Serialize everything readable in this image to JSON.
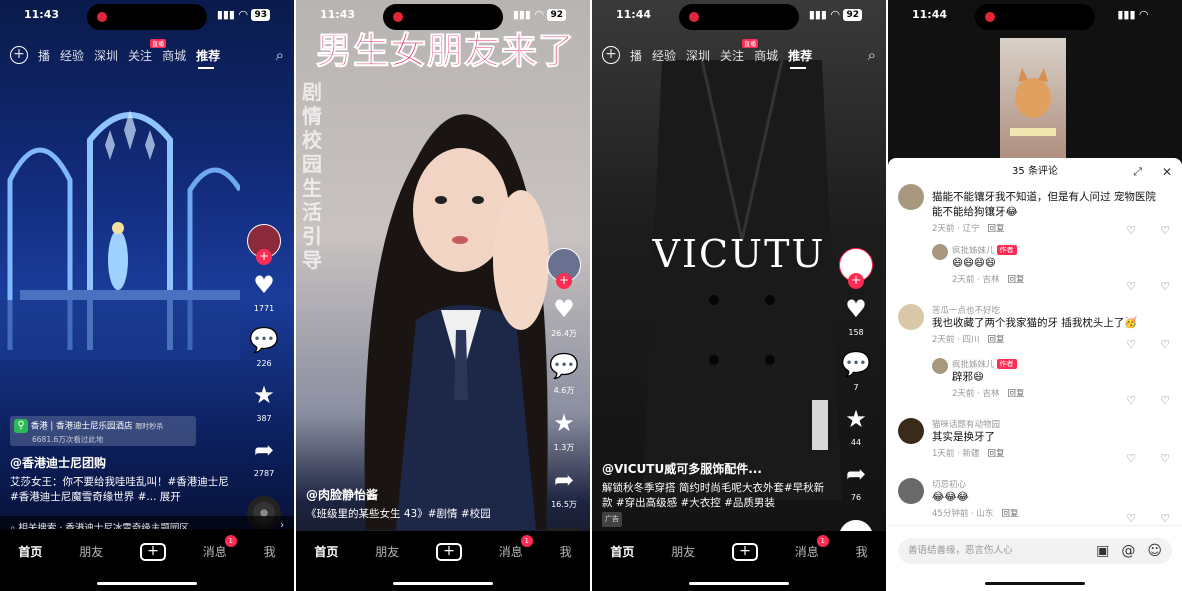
{
  "phones": [
    {
      "time": "11:43",
      "battery": "93",
      "nav": {
        "plus": "+",
        "tabs": [
          "播",
          "经验",
          "深圳",
          "关注",
          "商城",
          "推荐"
        ],
        "live_badge": "直播",
        "active": "推荐"
      },
      "rail": {
        "likes": "1771",
        "comments": "226",
        "favorites": "387",
        "shares": "2787"
      },
      "location": {
        "city": "香港",
        "place": "香港迪士尼乐园酒店",
        "promo": "限时秒杀",
        "views": "6681.6万次看过此地"
      },
      "author": "@香港迪士尼团购",
      "caption": "艾莎女王：你不要给我哇哇乱叫！#香港迪士尼 #香港迪士尼魔雪奇缘世界 #... 展开",
      "related": "相关搜索 · 香港迪士尼冰雪奇缘主题园区",
      "bottom": [
        "首页",
        "朋友",
        "+",
        "消息",
        "我"
      ],
      "msg_badge": "1"
    },
    {
      "time": "11:43",
      "battery": "92",
      "title_overlay": "男生女朋友来了",
      "vertical_text": "剧情校园生活引导",
      "rail": {
        "likes": "26.4万",
        "comments": "4.6万",
        "favorites": "1.3万",
        "shares": "16.5万"
      },
      "author": "@肉脸静怡酱",
      "caption": "《班级里的某些女生 43》#剧情 #校园",
      "bottom": [
        "首页",
        "朋友",
        "+",
        "消息",
        "我"
      ],
      "msg_badge": "1"
    },
    {
      "time": "11:44",
      "battery": "92",
      "nav": {
        "plus": "+",
        "tabs": [
          "播",
          "经验",
          "深圳",
          "关注",
          "商城",
          "推荐"
        ],
        "live_badge": "直播",
        "active": "推荐"
      },
      "brand": "VICUTU",
      "rail": {
        "likes": "158",
        "comments": "7",
        "favorites": "44",
        "shares": "76"
      },
      "author": "@VICUTU威可多服饰配件...",
      "caption": "解锁秋冬季穿搭 简约时尚毛呢大衣外套#早秋新款 #穿出高级感 #大衣控 #品质男装",
      "ad": "广告",
      "bottom": [
        "首页",
        "朋友",
        "+",
        "消息",
        "我"
      ],
      "msg_badge": "1"
    },
    {
      "time": "11:44",
      "header": "35 条评论",
      "comments": [
        {
          "name": "",
          "text": "猫能不能镶牙我不知道，但是有人问过 宠物医院能不能给狗镶牙😂",
          "meta": "2天前 · 辽宁",
          "reply": "回复"
        },
        {
          "name": "疯批姊妹儿",
          "tag": "作者",
          "text": "😄😄😄😄",
          "meta": "2天前 · 吉林",
          "reply": "回复"
        },
        {
          "name": "苦瓜一点也不好吃",
          "text": "我也收藏了两个我家猫的牙 插我枕头上了🥳",
          "meta": "2天前 · 四川",
          "reply": "回复"
        },
        {
          "name": "疯批姊妹儿",
          "tag": "作者",
          "text": "辟邪😄",
          "meta": "2天前 · 吉林",
          "reply": "回复"
        },
        {
          "name": "猫咪话题有动物园",
          "text": "其实是换牙了",
          "meta": "1天前 · 新疆",
          "reply": "回复"
        },
        {
          "name": "切忌初心",
          "text": "😂😂😂",
          "meta": "45分钟前 · 山东",
          "reply": "回复"
        }
      ],
      "input_placeholder": "善语结善缘，恶言伤人心"
    }
  ]
}
